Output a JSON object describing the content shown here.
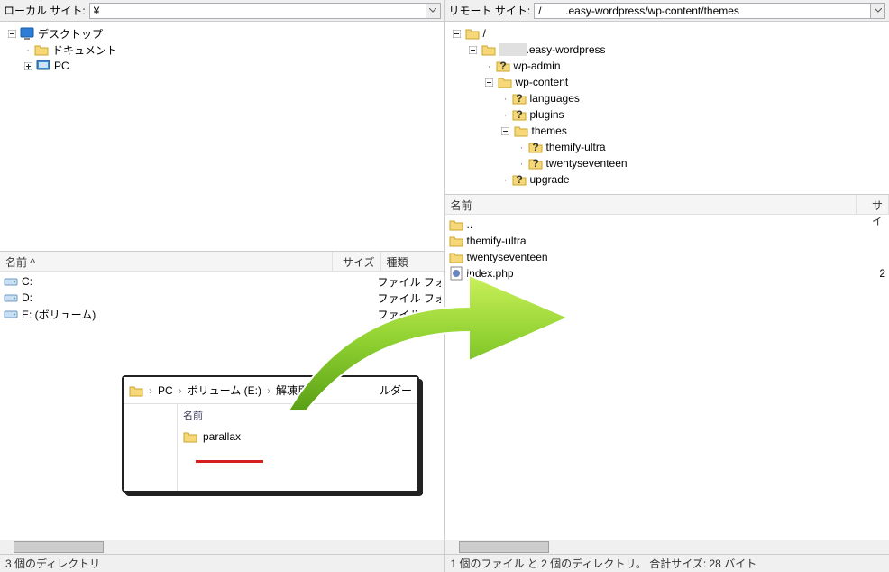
{
  "local": {
    "site_label": "ローカル サイト:",
    "site_path": "¥",
    "tree": {
      "root": "デスクトップ",
      "children": [
        "ドキュメント",
        "PC"
      ]
    },
    "list_headers": {
      "name": "名前",
      "size": "サイズ",
      "type": "種類"
    },
    "sort_indicator": "^",
    "rows": [
      {
        "name": "C:",
        "type": "ファイル フォル"
      },
      {
        "name": "D:",
        "type": "ファイル フォル"
      },
      {
        "name": "E: (ボリューム)",
        "type": "ファイル"
      }
    ],
    "status": "3 個のディレクトリ"
  },
  "remote": {
    "site_label": "リモート サイト:",
    "site_path": "/        .easy-wordpress/wp-content/themes",
    "tree_root": "/",
    "tree_site": ".easy-wordpress",
    "tree_items": {
      "wp_admin": "wp-admin",
      "wp_content": "wp-content",
      "languages": "languages",
      "plugins": "plugins",
      "themes": "themes",
      "themify_ultra": "themify-ultra",
      "twentyseventeen": "twentyseventeen",
      "upgrade": "upgrade"
    },
    "list_headers": {
      "name": "名前",
      "size": "サイ"
    },
    "rows": [
      {
        "name": "..",
        "kind": "up"
      },
      {
        "name": "themify-ultra",
        "kind": "folder"
      },
      {
        "name": "twentyseventeen",
        "kind": "folder"
      },
      {
        "name": "index.php",
        "kind": "php",
        "size": "2"
      }
    ],
    "status": "1 個のファイル と 2 個のディレクトリ。 合計サイズ: 28 バイト"
  },
  "explorer": {
    "breadcrumb": [
      "PC",
      "ボリューム (E:)",
      "解凍用"
    ],
    "breadcrumb_tail": "ルダー",
    "list_header": "名前",
    "item": "parallax"
  }
}
